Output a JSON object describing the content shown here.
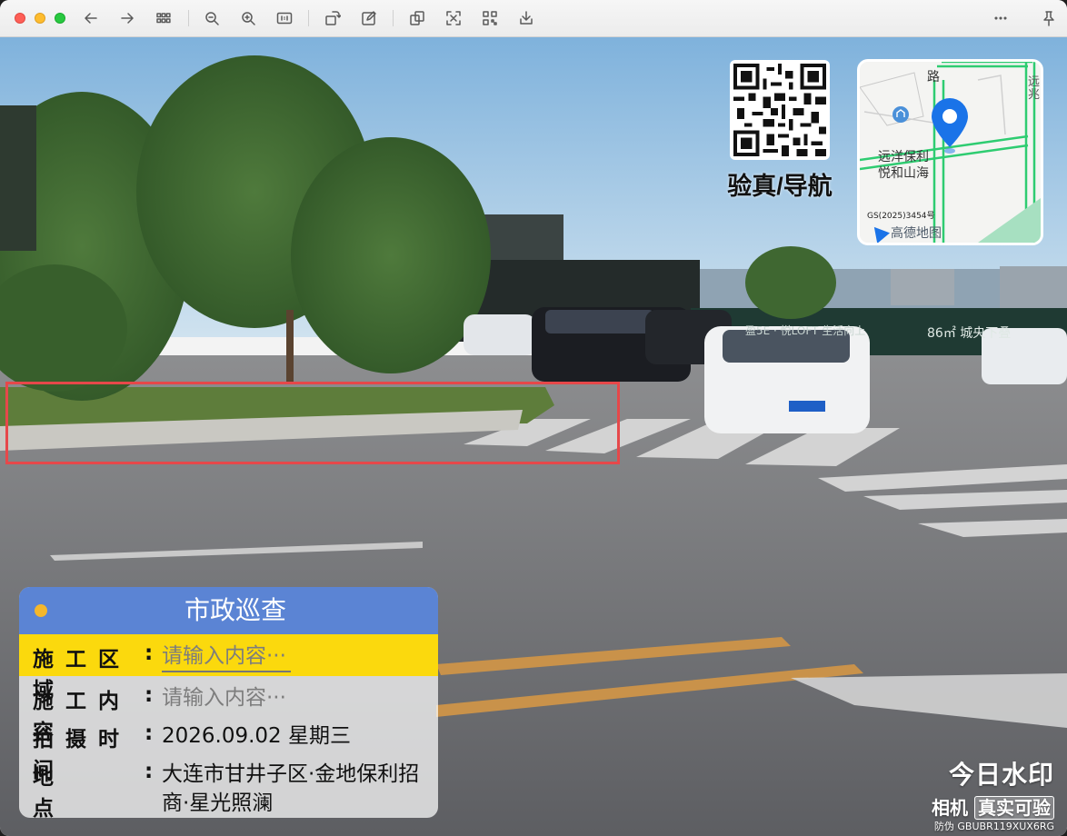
{
  "toolbar": {
    "buttons": [
      "back-icon",
      "forward-icon",
      "grid-view-icon",
      "zoom-out-icon",
      "zoom-in-icon",
      "actual-size-icon",
      "rotate-icon",
      "edit-icon",
      "copy-icon",
      "fit-icon",
      "qr-code-icon",
      "download-icon",
      "more-icon",
      "pin-icon"
    ]
  },
  "qr": {
    "label": "验真/导航"
  },
  "map": {
    "road_label": "路",
    "edge_label": "远兆",
    "poi": "远洋保利\n悦和山海",
    "approval_code": "GS(2025)3454号",
    "brand": "高德地图"
  },
  "card": {
    "title": "市政巡查",
    "rows": [
      {
        "label": "施工区域",
        "value": "请输入内容···",
        "placeholder": true,
        "highlighted": true
      },
      {
        "label": "施工内容",
        "value": "请输入内容···",
        "placeholder": true,
        "highlighted": false
      },
      {
        "label": "拍摄时间",
        "value": "2026.09.02 星期三",
        "placeholder": false,
        "highlighted": false
      },
      {
        "label": "地点",
        "value": "大连市甘井子区·金地保利招商·星光照澜",
        "placeholder": false,
        "highlighted": false
      }
    ]
  },
  "watermark": {
    "line1": "今日水印",
    "line2_a": "相机",
    "line2_b": "真实可验",
    "code": "防伪 GBUBR119XUX6RG"
  },
  "colors": {
    "card_header": "#5b84d4",
    "highlight": "#fbd90d",
    "annotation_box": "#e6484a",
    "map_pin": "#1a73e8"
  }
}
